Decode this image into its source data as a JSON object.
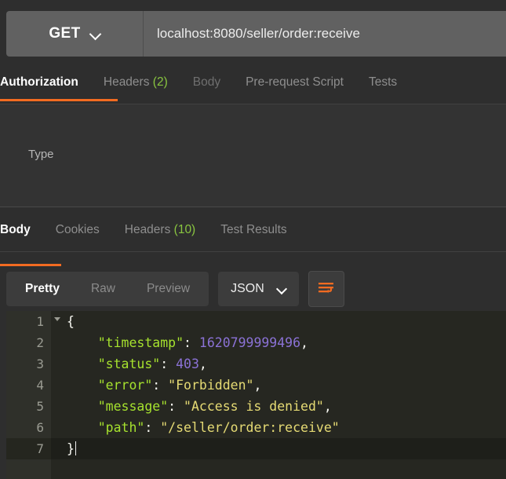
{
  "request_bar": {
    "method": "GET",
    "method_dropdown_icon": "chevron-down-icon",
    "url": "localhost:8080/seller/order:receive"
  },
  "request_tabs": [
    {
      "label": "Authorization",
      "count": "",
      "state": "active"
    },
    {
      "label": "Headers",
      "count": "(2)",
      "state": "normal"
    },
    {
      "label": "Body",
      "count": "",
      "state": "muted"
    },
    {
      "label": "Pre-request Script",
      "count": "",
      "state": "normal"
    },
    {
      "label": "Tests",
      "count": "",
      "state": "normal"
    }
  ],
  "authorization_pane": {
    "type_label": "Type"
  },
  "response_tabs": [
    {
      "label": "Body",
      "count": "",
      "state": "active"
    },
    {
      "label": "Cookies",
      "count": "",
      "state": "normal"
    },
    {
      "label": "Headers",
      "count": "(10)",
      "state": "normal"
    },
    {
      "label": "Test Results",
      "count": "",
      "state": "normal"
    }
  ],
  "response_toolbar": {
    "views": [
      {
        "label": "Pretty",
        "state": "active"
      },
      {
        "label": "Raw",
        "state": "normal"
      },
      {
        "label": "Preview",
        "state": "normal"
      }
    ],
    "format": "JSON",
    "format_dropdown_icon": "chevron-down-icon",
    "wrap_button_icon": "word-wrap-icon"
  },
  "response_body": {
    "lines": [
      {
        "number": "1",
        "folding": true,
        "active": false,
        "tokens": [
          {
            "t": "{",
            "c": "p"
          }
        ]
      },
      {
        "number": "2",
        "folding": false,
        "active": false,
        "tokens": [
          {
            "t": "    ",
            "c": "p"
          },
          {
            "t": "\"timestamp\"",
            "c": "k"
          },
          {
            "t": ": ",
            "c": "p"
          },
          {
            "t": "1620799999496",
            "c": "n"
          },
          {
            "t": ",",
            "c": "p"
          }
        ]
      },
      {
        "number": "3",
        "folding": false,
        "active": false,
        "tokens": [
          {
            "t": "    ",
            "c": "p"
          },
          {
            "t": "\"status\"",
            "c": "k"
          },
          {
            "t": ": ",
            "c": "p"
          },
          {
            "t": "403",
            "c": "n"
          },
          {
            "t": ",",
            "c": "p"
          }
        ]
      },
      {
        "number": "4",
        "folding": false,
        "active": false,
        "tokens": [
          {
            "t": "    ",
            "c": "p"
          },
          {
            "t": "\"error\"",
            "c": "k"
          },
          {
            "t": ": ",
            "c": "p"
          },
          {
            "t": "\"Forbidden\"",
            "c": "s"
          },
          {
            "t": ",",
            "c": "p"
          }
        ]
      },
      {
        "number": "5",
        "folding": false,
        "active": false,
        "tokens": [
          {
            "t": "    ",
            "c": "p"
          },
          {
            "t": "\"message\"",
            "c": "k"
          },
          {
            "t": ": ",
            "c": "p"
          },
          {
            "t": "\"Access is denied\"",
            "c": "s"
          },
          {
            "t": ",",
            "c": "p"
          }
        ]
      },
      {
        "number": "6",
        "folding": false,
        "active": false,
        "tokens": [
          {
            "t": "    ",
            "c": "p"
          },
          {
            "t": "\"path\"",
            "c": "k"
          },
          {
            "t": ": ",
            "c": "p"
          },
          {
            "t": "\"/seller/order:receive\"",
            "c": "s"
          }
        ]
      },
      {
        "number": "7",
        "folding": false,
        "active": true,
        "caret": true,
        "tokens": [
          {
            "t": "}",
            "c": "p"
          }
        ]
      }
    ]
  },
  "colors": {
    "accent_orange": "#f26b21",
    "count_green": "#89c540",
    "editor_bg": "#262721",
    "gutter_bg": "#2f302a",
    "json_key": "#a6e22e",
    "json_string": "#e6db74",
    "json_number": "#8b72d6",
    "panel_bg": "#333333",
    "toolbar_bg": "#2e2e2e",
    "urlbar_bg": "#616161"
  }
}
